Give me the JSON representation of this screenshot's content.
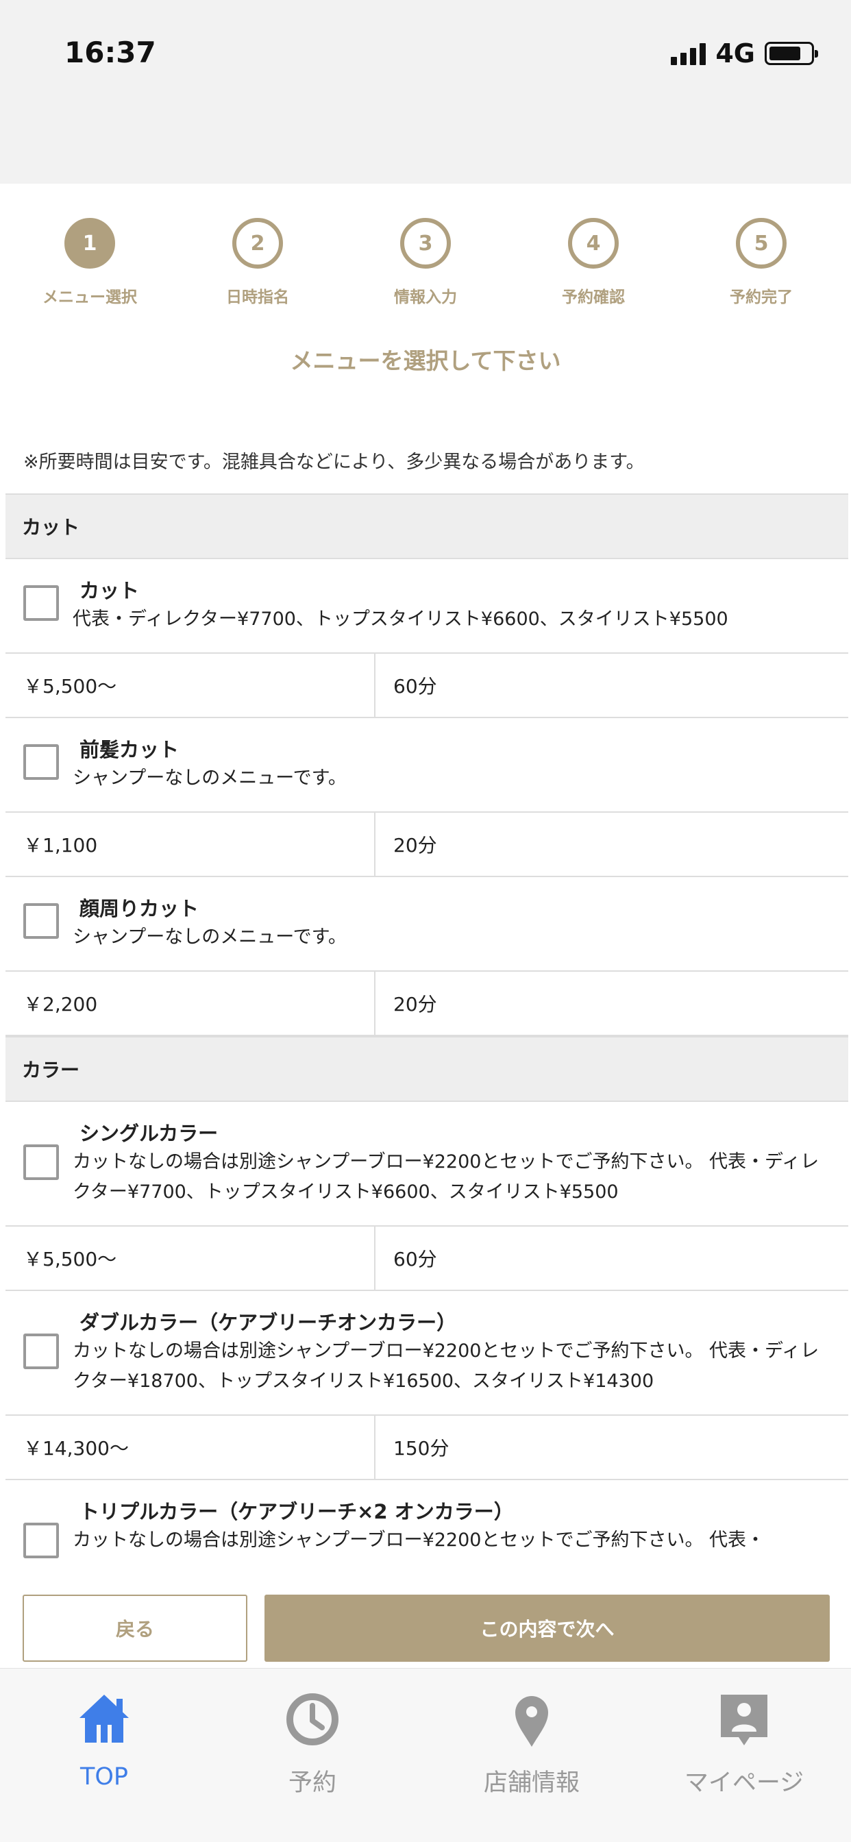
{
  "status_bar": {
    "time": "16:37",
    "network": "4G"
  },
  "steps": [
    {
      "number": "1",
      "label": "メニュー選択",
      "active": true
    },
    {
      "number": "2",
      "label": "日時指名",
      "active": false
    },
    {
      "number": "3",
      "label": "情報入力",
      "active": false
    },
    {
      "number": "4",
      "label": "予約確認",
      "active": false
    },
    {
      "number": "5",
      "label": "予約完了",
      "active": false
    }
  ],
  "heading": "メニューを選択して下さい",
  "note": "※所要時間は目安です。混雑具合などにより、多少異なる場合があります。",
  "categories": [
    {
      "name": "カット",
      "items": [
        {
          "name": "カット",
          "desc": "代表・ディレクター¥7700、トップスタイリスト¥6600、スタイリスト¥5500",
          "price": "￥5,500〜",
          "duration": "60分",
          "checked": false
        },
        {
          "name": "前髪カット",
          "desc": "シャンプーなしのメニューです。",
          "price": "￥1,100",
          "duration": "20分",
          "checked": false
        },
        {
          "name": "顔周りカット",
          "desc": "シャンプーなしのメニューです。",
          "price": "￥2,200",
          "duration": "20分",
          "checked": false
        }
      ]
    },
    {
      "name": "カラー",
      "items": [
        {
          "name": "シングルカラー",
          "desc": "カットなしの場合は別途シャンプーブロー¥2200とセットでご予約下さい。 代表・ディレクター¥7700、トップスタイリスト¥6600、スタイリスト¥5500",
          "price": "￥5,500〜",
          "duration": "60分",
          "checked": false
        },
        {
          "name": "ダブルカラー（ケアブリーチオンカラー）",
          "desc": "カットなしの場合は別途シャンプーブロー¥2200とセットでご予約下さい。 代表・ディレクター¥18700、トップスタイリスト¥16500、スタイリスト¥14300",
          "price": "￥14,300〜",
          "duration": "150分",
          "checked": false
        },
        {
          "name": "トリプルカラー（ケアブリーチ×2 オンカラー）",
          "desc": "カットなしの場合は別途シャンプーブロー¥2200とセットでご予約下さい。 代表・",
          "price": "",
          "duration": "",
          "checked": false
        }
      ]
    }
  ],
  "actions": {
    "back_label": "戻る",
    "next_label": "この内容で次へ"
  },
  "tabbar": [
    {
      "label": "TOP",
      "icon": "home-icon",
      "active": true
    },
    {
      "label": "予約",
      "icon": "clock-icon",
      "active": false
    },
    {
      "label": "店舗情報",
      "icon": "map-pin-icon",
      "active": false
    },
    {
      "label": "マイページ",
      "icon": "profile-icon",
      "active": false
    }
  ],
  "colors": {
    "accent": "#b0a07f",
    "tab_active": "#3f7ee8",
    "tab_inactive": "#999999"
  }
}
